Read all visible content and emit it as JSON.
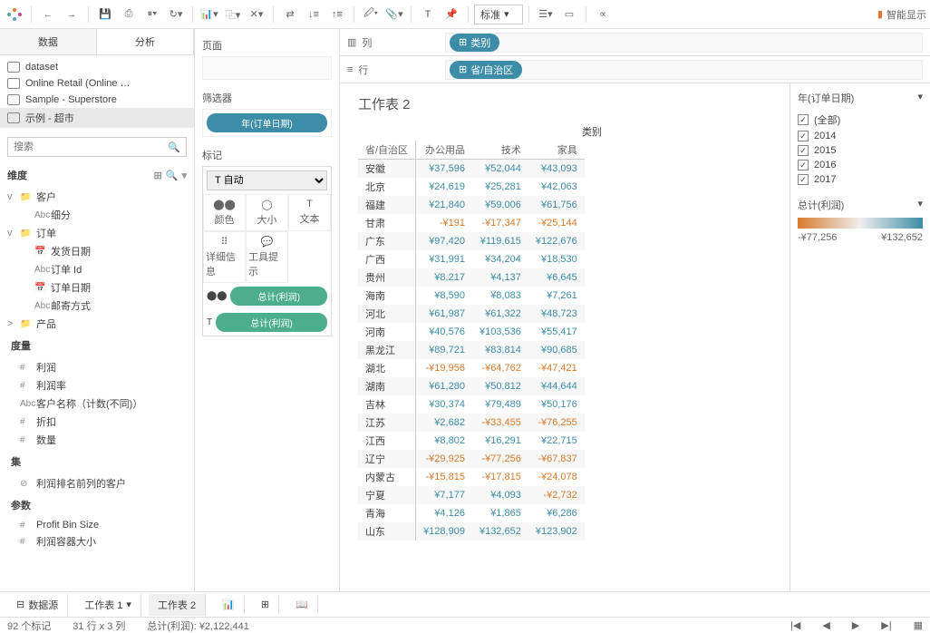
{
  "toolbar": {
    "std_label": "标准",
    "smart_label": "智能显示"
  },
  "left": {
    "tab_data": "数据",
    "tab_analysis": "分析",
    "datasources": [
      "dataset",
      "Online Retail (Online …",
      "Sample - Superstore",
      "示例 - 超市"
    ],
    "search_placeholder": "搜索",
    "dim_label": "维度",
    "dim_tree": [
      {
        "caret": "v",
        "ico": "📁",
        "label": "客户",
        "indent": 0
      },
      {
        "caret": "",
        "ico": "Abc",
        "label": "细分",
        "indent": 1
      },
      {
        "caret": "v",
        "ico": "📁",
        "label": "订单",
        "indent": 0
      },
      {
        "caret": "",
        "ico": "📅",
        "label": "发货日期",
        "indent": 1
      },
      {
        "caret": "",
        "ico": "Abc",
        "label": "订单 Id",
        "indent": 1
      },
      {
        "caret": "",
        "ico": "📅",
        "label": "订单日期",
        "indent": 1
      },
      {
        "caret": "",
        "ico": "Abc",
        "label": "邮寄方式",
        "indent": 1
      },
      {
        "caret": ">",
        "ico": "📁",
        "label": "产品",
        "indent": 0
      }
    ],
    "meas_label": "度量",
    "measures": [
      {
        "ico": "#",
        "label": "利润"
      },
      {
        "ico": "#",
        "label": "利润率"
      },
      {
        "ico": "Abc",
        "label": "客户名称（计数(不同)）"
      },
      {
        "ico": "#",
        "label": "折扣"
      },
      {
        "ico": "#",
        "label": "数量"
      }
    ],
    "set_label": "集",
    "sets": [
      {
        "ico": "⊘",
        "label": "利润排名前列的客户"
      }
    ],
    "param_label": "参数",
    "params": [
      {
        "ico": "#",
        "label": "Profit Bin Size"
      },
      {
        "ico": "#",
        "label": "利润容器大小"
      }
    ]
  },
  "mid": {
    "pages": "页面",
    "filters": "筛选器",
    "filter_pill": "年(订单日期)",
    "marks": "标记",
    "mark_type": "自动",
    "mark_cells": [
      "颜色",
      "大小",
      "文本",
      "详细信息",
      "工具提示"
    ],
    "mark_ico": [
      "⬤⬤",
      "◯",
      "T",
      "⠿",
      "💬"
    ],
    "pill1": "总计(利润)",
    "pill2": "总计(利润)"
  },
  "shelves": {
    "col_label": "列",
    "col_pill": "类别",
    "row_label": "行",
    "row_pill": "省/自治区"
  },
  "viz": {
    "title": "工作表 2",
    "super": "类别",
    "headers": [
      "省/自治区",
      "办公用品",
      "技术",
      "家具"
    ],
    "rows": [
      [
        "安徽",
        "¥37,596",
        "¥52,044",
        "¥43,093"
      ],
      [
        "北京",
        "¥24,619",
        "¥25,281",
        "¥42,063"
      ],
      [
        "福建",
        "¥21,840",
        "¥59,006",
        "¥61,756"
      ],
      [
        "甘肃",
        "-¥191",
        "-¥17,347",
        "-¥25,144"
      ],
      [
        "广东",
        "¥97,420",
        "¥119,615",
        "¥122,676"
      ],
      [
        "广西",
        "¥31,991",
        "¥34,204",
        "¥18,530"
      ],
      [
        "贵州",
        "¥8,217",
        "¥4,137",
        "¥6,645"
      ],
      [
        "海南",
        "¥8,590",
        "¥8,083",
        "¥7,261"
      ],
      [
        "河北",
        "¥61,987",
        "¥61,322",
        "¥48,723"
      ],
      [
        "河南",
        "¥40,576",
        "¥103,536",
        "¥55,417"
      ],
      [
        "黑龙江",
        "¥89,721",
        "¥83,814",
        "¥90,685"
      ],
      [
        "湖北",
        "-¥19,956",
        "-¥64,762",
        "-¥47,421"
      ],
      [
        "湖南",
        "¥61,280",
        "¥50,812",
        "¥44,644"
      ],
      [
        "吉林",
        "¥30,374",
        "¥79,489",
        "¥50,176"
      ],
      [
        "江苏",
        "¥2,682",
        "-¥33,455",
        "-¥76,255"
      ],
      [
        "江西",
        "¥8,802",
        "¥16,291",
        "¥22,715"
      ],
      [
        "辽宁",
        "-¥29,925",
        "-¥77,256",
        "-¥67,837"
      ],
      [
        "内蒙古",
        "-¥15,815",
        "-¥17,815",
        "-¥24,078"
      ],
      [
        "宁夏",
        "¥7,177",
        "¥4,093",
        "-¥2,732"
      ],
      [
        "青海",
        "¥4,126",
        "¥1,865",
        "¥6,286"
      ],
      [
        "山东",
        "¥128,909",
        "¥132,652",
        "¥123,902"
      ]
    ]
  },
  "legend": {
    "year_title": "年(订单日期)",
    "years": [
      "(全部)",
      "2014",
      "2015",
      "2016",
      "2017"
    ],
    "sum_title": "总计(利润)",
    "min": "-¥77,256",
    "max": "¥132,652"
  },
  "bottom": {
    "datasource": "数据源",
    "ws1": "工作表 1",
    "ws2": "工作表 2"
  },
  "status": {
    "marks": "92 个标记",
    "rc": "31 行 x 3 列",
    "sum": "总计(利润): ¥2,122,441"
  }
}
